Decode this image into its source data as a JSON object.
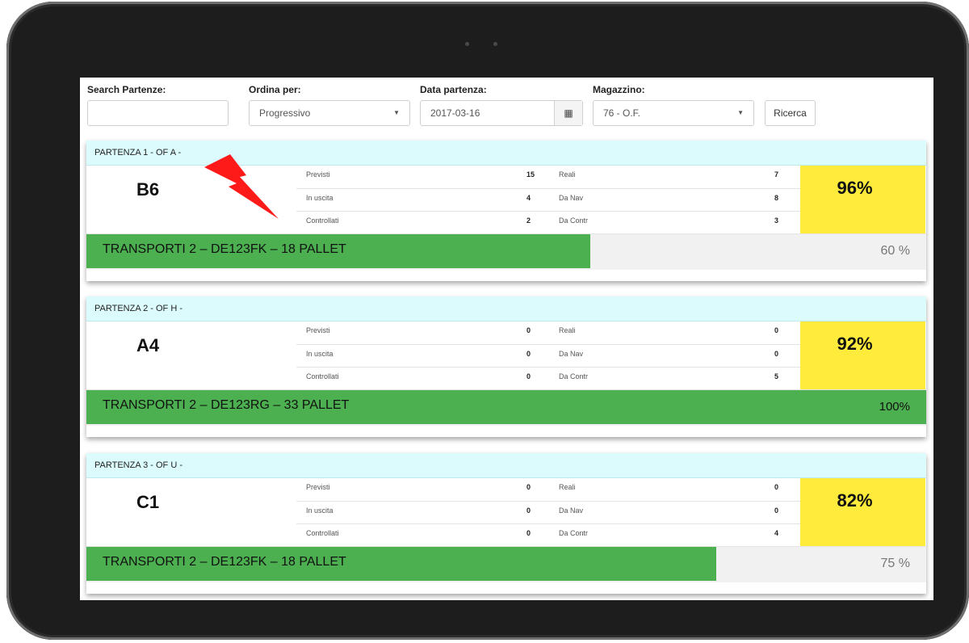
{
  "filters": {
    "search_label": "Search Partenze:",
    "search_value": "",
    "order_label": "Ordina per:",
    "order_value": "Progressivo",
    "date_label": "Data partenza:",
    "date_value": "2017-03-16",
    "warehouse_label": "Magazzino:",
    "warehouse_value": "76 - O.F.",
    "search_button": "Ricerca"
  },
  "departures": [
    {
      "header": "PARTENZA 1 - OF A -",
      "code": "B6",
      "previsti_label": "Previsti",
      "previsti": "15",
      "reali_label": "Reali",
      "reali": "7",
      "inuscita_label": "In uscita",
      "inuscita": "4",
      "danav_label": "Da Nav",
      "danav": "8",
      "controllati_label": "Controllati",
      "controllati": "2",
      "dacontr_label": "Da Contr",
      "dacontr": "3",
      "percent": "96%",
      "transport": "TRANSPORTI 2 – DE123FK – 18 PALLET",
      "progress_label": "60 %",
      "progress": 0.6,
      "alert": true
    },
    {
      "header": "PARTENZA 2 - OF H -",
      "code": "A4",
      "previsti_label": "Previsti",
      "previsti": "0",
      "reali_label": "Reali",
      "reali": "0",
      "inuscita_label": "In uscita",
      "inuscita": "0",
      "danav_label": "Da Nav",
      "danav": "0",
      "controllati_label": "Controllati",
      "controllati": "0",
      "dacontr_label": "Da Contr",
      "dacontr": "5",
      "percent": "92%",
      "transport": "TRANSPORTI 2 – DE123RG – 33 PALLET",
      "progress_label": "100%",
      "progress": 1.0,
      "alert": false
    },
    {
      "header": "PARTENZA 3 - OF U -",
      "code": "C1",
      "previsti_label": "Previsti",
      "previsti": "0",
      "reali_label": "Reali",
      "reali": "0",
      "inuscita_label": "In uscita",
      "inuscita": "0",
      "danav_label": "Da Nav",
      "danav": "0",
      "controllati_label": "Controllati",
      "controllati": "0",
      "dacontr_label": "Da Contr",
      "dacontr": "4",
      "percent": "82%",
      "transport": "TRANSPORTI 2 – DE123FK – 18 PALLET",
      "progress_label": "75 %",
      "progress": 0.75,
      "alert": false
    }
  ],
  "icons": {
    "calendar": "calendar-icon",
    "alert": "lightning-bolt-icon"
  },
  "colors": {
    "header_bg": "#dcfbfd",
    "percent_bg": "#ffeb3b",
    "progress_fill": "#4caf50",
    "alert": "#ff1a1a"
  }
}
